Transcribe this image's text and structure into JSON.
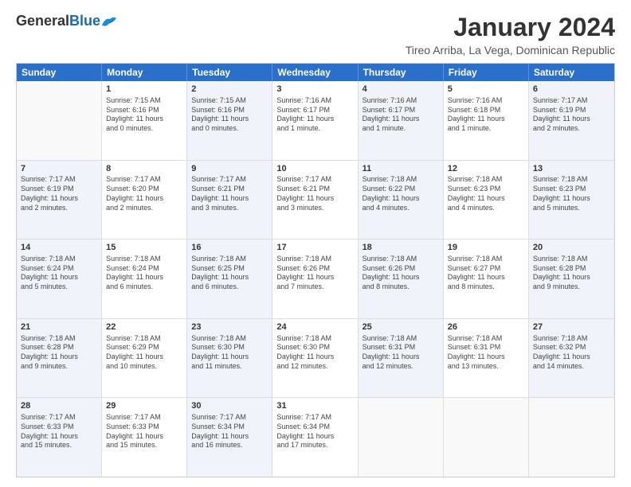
{
  "logo": {
    "general": "General",
    "blue": "Blue"
  },
  "title": "January 2024",
  "subtitle": "Tireo Arriba, La Vega, Dominican Republic",
  "days": [
    "Sunday",
    "Monday",
    "Tuesday",
    "Wednesday",
    "Thursday",
    "Friday",
    "Saturday"
  ],
  "weeks": [
    [
      {
        "day": "",
        "content": ""
      },
      {
        "day": "1",
        "content": "Sunrise: 7:15 AM\nSunset: 6:16 PM\nDaylight: 11 hours\nand 0 minutes."
      },
      {
        "day": "2",
        "content": "Sunrise: 7:15 AM\nSunset: 6:16 PM\nDaylight: 11 hours\nand 0 minutes."
      },
      {
        "day": "3",
        "content": "Sunrise: 7:16 AM\nSunset: 6:17 PM\nDaylight: 11 hours\nand 1 minute."
      },
      {
        "day": "4",
        "content": "Sunrise: 7:16 AM\nSunset: 6:17 PM\nDaylight: 11 hours\nand 1 minute."
      },
      {
        "day": "5",
        "content": "Sunrise: 7:16 AM\nSunset: 6:18 PM\nDaylight: 11 hours\nand 1 minute."
      },
      {
        "day": "6",
        "content": "Sunrise: 7:17 AM\nSunset: 6:19 PM\nDaylight: 11 hours\nand 2 minutes."
      }
    ],
    [
      {
        "day": "7",
        "content": "Sunrise: 7:17 AM\nSunset: 6:19 PM\nDaylight: 11 hours\nand 2 minutes."
      },
      {
        "day": "8",
        "content": "Sunrise: 7:17 AM\nSunset: 6:20 PM\nDaylight: 11 hours\nand 2 minutes."
      },
      {
        "day": "9",
        "content": "Sunrise: 7:17 AM\nSunset: 6:21 PM\nDaylight: 11 hours\nand 3 minutes."
      },
      {
        "day": "10",
        "content": "Sunrise: 7:17 AM\nSunset: 6:21 PM\nDaylight: 11 hours\nand 3 minutes."
      },
      {
        "day": "11",
        "content": "Sunrise: 7:18 AM\nSunset: 6:22 PM\nDaylight: 11 hours\nand 4 minutes."
      },
      {
        "day": "12",
        "content": "Sunrise: 7:18 AM\nSunset: 6:23 PM\nDaylight: 11 hours\nand 4 minutes."
      },
      {
        "day": "13",
        "content": "Sunrise: 7:18 AM\nSunset: 6:23 PM\nDaylight: 11 hours\nand 5 minutes."
      }
    ],
    [
      {
        "day": "14",
        "content": "Sunrise: 7:18 AM\nSunset: 6:24 PM\nDaylight: 11 hours\nand 5 minutes."
      },
      {
        "day": "15",
        "content": "Sunrise: 7:18 AM\nSunset: 6:24 PM\nDaylight: 11 hours\nand 6 minutes."
      },
      {
        "day": "16",
        "content": "Sunrise: 7:18 AM\nSunset: 6:25 PM\nDaylight: 11 hours\nand 6 minutes."
      },
      {
        "day": "17",
        "content": "Sunrise: 7:18 AM\nSunset: 6:26 PM\nDaylight: 11 hours\nand 7 minutes."
      },
      {
        "day": "18",
        "content": "Sunrise: 7:18 AM\nSunset: 6:26 PM\nDaylight: 11 hours\nand 8 minutes."
      },
      {
        "day": "19",
        "content": "Sunrise: 7:18 AM\nSunset: 6:27 PM\nDaylight: 11 hours\nand 8 minutes."
      },
      {
        "day": "20",
        "content": "Sunrise: 7:18 AM\nSunset: 6:28 PM\nDaylight: 11 hours\nand 9 minutes."
      }
    ],
    [
      {
        "day": "21",
        "content": "Sunrise: 7:18 AM\nSunset: 6:28 PM\nDaylight: 11 hours\nand 9 minutes."
      },
      {
        "day": "22",
        "content": "Sunrise: 7:18 AM\nSunset: 6:29 PM\nDaylight: 11 hours\nand 10 minutes."
      },
      {
        "day": "23",
        "content": "Sunrise: 7:18 AM\nSunset: 6:30 PM\nDaylight: 11 hours\nand 11 minutes."
      },
      {
        "day": "24",
        "content": "Sunrise: 7:18 AM\nSunset: 6:30 PM\nDaylight: 11 hours\nand 12 minutes."
      },
      {
        "day": "25",
        "content": "Sunrise: 7:18 AM\nSunset: 6:31 PM\nDaylight: 11 hours\nand 12 minutes."
      },
      {
        "day": "26",
        "content": "Sunrise: 7:18 AM\nSunset: 6:31 PM\nDaylight: 11 hours\nand 13 minutes."
      },
      {
        "day": "27",
        "content": "Sunrise: 7:18 AM\nSunset: 6:32 PM\nDaylight: 11 hours\nand 14 minutes."
      }
    ],
    [
      {
        "day": "28",
        "content": "Sunrise: 7:17 AM\nSunset: 6:33 PM\nDaylight: 11 hours\nand 15 minutes."
      },
      {
        "day": "29",
        "content": "Sunrise: 7:17 AM\nSunset: 6:33 PM\nDaylight: 11 hours\nand 15 minutes."
      },
      {
        "day": "30",
        "content": "Sunrise: 7:17 AM\nSunset: 6:34 PM\nDaylight: 11 hours\nand 16 minutes."
      },
      {
        "day": "31",
        "content": "Sunrise: 7:17 AM\nSunset: 6:34 PM\nDaylight: 11 hours\nand 17 minutes."
      },
      {
        "day": "",
        "content": ""
      },
      {
        "day": "",
        "content": ""
      },
      {
        "day": "",
        "content": ""
      }
    ]
  ]
}
